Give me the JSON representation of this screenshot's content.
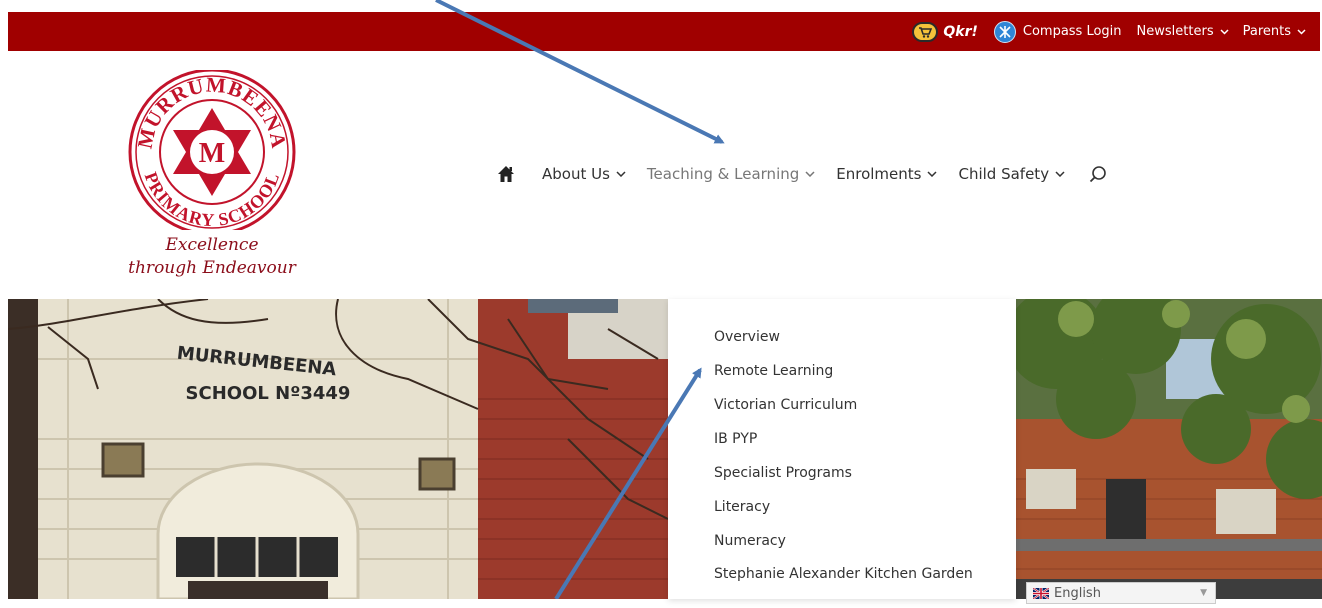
{
  "topbar": {
    "qkr_label": "Qkr!",
    "compass_label": "Compass Login",
    "newsletters_label": "Newsletters",
    "parents_label": "Parents",
    "bg_color": "#a00000"
  },
  "logo": {
    "motto_line1": "Excellence",
    "motto_line2": "through Endeavour",
    "crest_text_top": "MURRUMBEENA",
    "crest_text_bottom": "PRIMARY SCHOOL",
    "crest_letter": "M"
  },
  "nav": {
    "home_icon": "home-icon",
    "items": [
      {
        "label": "About Us"
      },
      {
        "label": "Teaching & Learning",
        "active": true
      },
      {
        "label": "Enrolments"
      },
      {
        "label": "Child Safety"
      }
    ],
    "search_icon": "search-icon"
  },
  "photo": {
    "building_sign_line1": "MURRUMBEENA",
    "building_sign_line2": "SCHOOL Nº3449"
  },
  "dropdown": {
    "items": [
      "Overview",
      "Remote Learning",
      "Victorian Curriculum",
      "IB PYP",
      "Specialist Programs",
      "Literacy",
      "Numeracy",
      "Stephanie Alexander Kitchen Garden"
    ]
  },
  "language": {
    "selected": "English"
  },
  "colors": {
    "brand_red": "#a00000",
    "crest_red": "#c2132b",
    "arrow_blue": "#4a78b4"
  }
}
